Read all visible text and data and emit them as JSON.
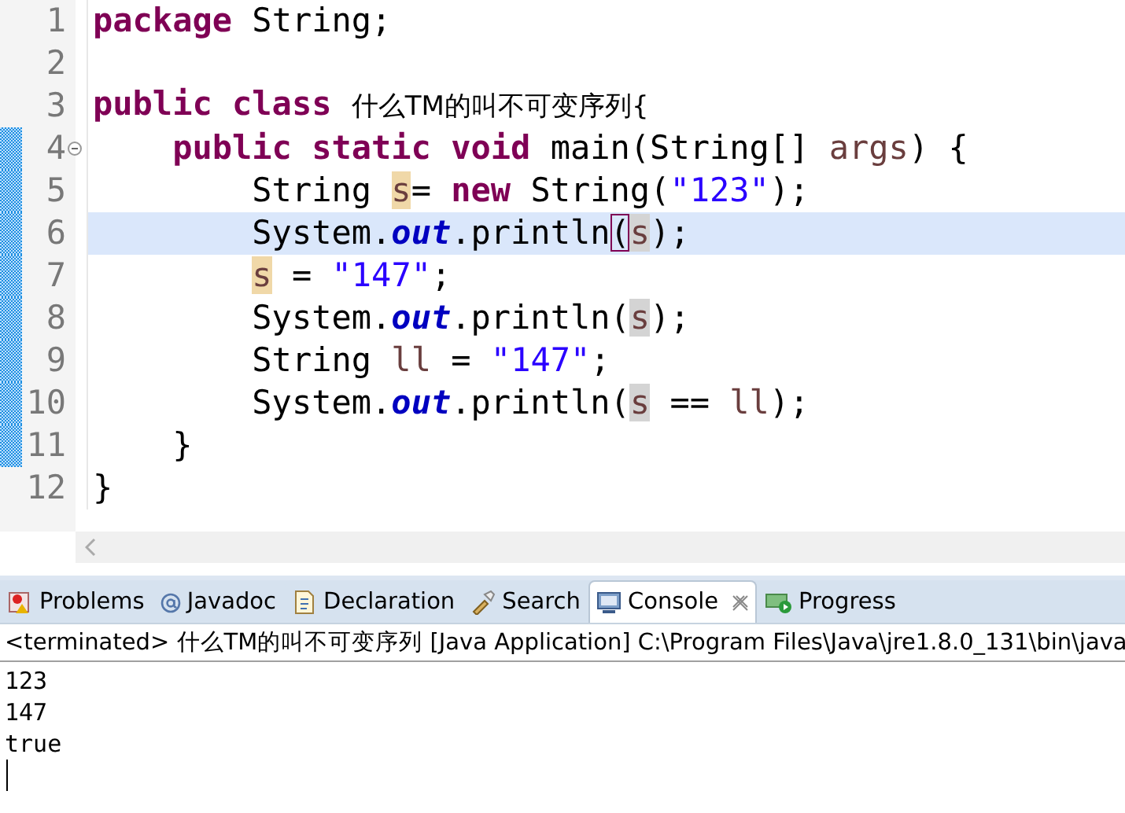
{
  "editor": {
    "lines": [
      {
        "number": "1",
        "changed": false,
        "current": false,
        "foldable": false,
        "tokens": [
          {
            "text": "package",
            "kind": "keyword"
          },
          {
            "text": " String;",
            "kind": "plain"
          }
        ]
      },
      {
        "number": "2",
        "changed": false,
        "current": false,
        "foldable": false
      },
      {
        "number": "3",
        "changed": false,
        "current": false,
        "foldable": false,
        "tokens": [
          {
            "text": "public",
            "kind": "keyword"
          },
          {
            "text": " class",
            "kind": "keyword"
          },
          {
            "text": " 什么TM的叫不可变序列{",
            "kind": "cjk"
          }
        ]
      },
      {
        "number": "4",
        "changed": true,
        "current": false,
        "foldable": true,
        "tokens": [
          {
            "text": "    public",
            "kind": "keyword"
          },
          {
            "text": " static",
            "kind": "keyword"
          },
          {
            "text": " void",
            "kind": "keyword"
          },
          {
            "text": " main(String[] ",
            "kind": "plain"
          },
          {
            "text": "args",
            "kind": "local"
          },
          {
            "text": ") {",
            "kind": "plain"
          }
        ]
      },
      {
        "number": "5",
        "changed": true,
        "current": false,
        "foldable": false,
        "tokens": [
          {
            "text": "        String ",
            "kind": "plain"
          },
          {
            "text": "s",
            "kind": "local-write"
          },
          {
            "text": "= ",
            "kind": "plain"
          },
          {
            "text": "new",
            "kind": "keyword"
          },
          {
            "text": " String(",
            "kind": "plain"
          },
          {
            "text": "\"123\"",
            "kind": "string"
          },
          {
            "text": ");",
            "kind": "plain"
          }
        ]
      },
      {
        "number": "6",
        "changed": true,
        "current": true,
        "foldable": false,
        "tokens": [
          {
            "text": "        System.",
            "kind": "plain"
          },
          {
            "text": "out",
            "kind": "field"
          },
          {
            "text": ".println",
            "kind": "plain"
          },
          {
            "text": "(",
            "kind": "bracket-match"
          },
          {
            "text": "s",
            "kind": "local-read"
          },
          {
            "text": ");",
            "kind": "plain"
          }
        ]
      },
      {
        "number": "7",
        "changed": true,
        "current": false,
        "foldable": false,
        "tokens": [
          {
            "text": "        s",
            "kind": "local-write"
          },
          {
            "text": " = ",
            "kind": "plain"
          },
          {
            "text": "\"147\"",
            "kind": "string"
          },
          {
            "text": ";",
            "kind": "plain"
          }
        ]
      },
      {
        "number": "8",
        "changed": true,
        "current": false,
        "foldable": false,
        "tokens": [
          {
            "text": "        System.",
            "kind": "plain"
          },
          {
            "text": "out",
            "kind": "field"
          },
          {
            "text": ".println(",
            "kind": "plain"
          },
          {
            "text": "s",
            "kind": "local-read"
          },
          {
            "text": ");",
            "kind": "plain"
          }
        ]
      },
      {
        "number": "9",
        "changed": true,
        "current": false,
        "foldable": false,
        "tokens": [
          {
            "text": "        String ",
            "kind": "plain"
          },
          {
            "text": "ll",
            "kind": "local"
          },
          {
            "text": " = ",
            "kind": "plain"
          },
          {
            "text": "\"147\"",
            "kind": "string"
          },
          {
            "text": ";",
            "kind": "plain"
          }
        ]
      },
      {
        "number": "10",
        "changed": true,
        "current": false,
        "foldable": false,
        "tokens": [
          {
            "text": "        System.",
            "kind": "plain"
          },
          {
            "text": "out",
            "kind": "field"
          },
          {
            "text": ".println(",
            "kind": "plain"
          },
          {
            "text": "s",
            "kind": "local-read"
          },
          {
            "text": " == ",
            "kind": "plain"
          },
          {
            "text": "ll",
            "kind": "local"
          },
          {
            "text": ");",
            "kind": "plain"
          }
        ]
      },
      {
        "number": "11",
        "changed": true,
        "current": false,
        "foldable": false,
        "tokens": [
          {
            "text": "    }",
            "kind": "plain"
          }
        ]
      },
      {
        "number": "12",
        "changed": false,
        "current": false,
        "foldable": false,
        "tokens": [
          {
            "text": "}",
            "kind": "plain"
          }
        ]
      }
    ]
  },
  "tabs": [
    {
      "label": "Problems",
      "selected": false,
      "closable": false
    },
    {
      "label": "Javadoc",
      "selected": false,
      "closable": false
    },
    {
      "label": "Declaration",
      "selected": false,
      "closable": false
    },
    {
      "label": "Search",
      "selected": false,
      "closable": false
    },
    {
      "label": "Console",
      "selected": true,
      "closable": true
    },
    {
      "label": "Progress",
      "selected": false,
      "closable": false
    }
  ],
  "console": {
    "header": "<terminated> 什么TM的叫不可变序列 [Java Application] C:\\Program Files\\Java\\jre1.8.0_131\\bin\\java",
    "output": [
      "123",
      "147",
      "true"
    ]
  }
}
